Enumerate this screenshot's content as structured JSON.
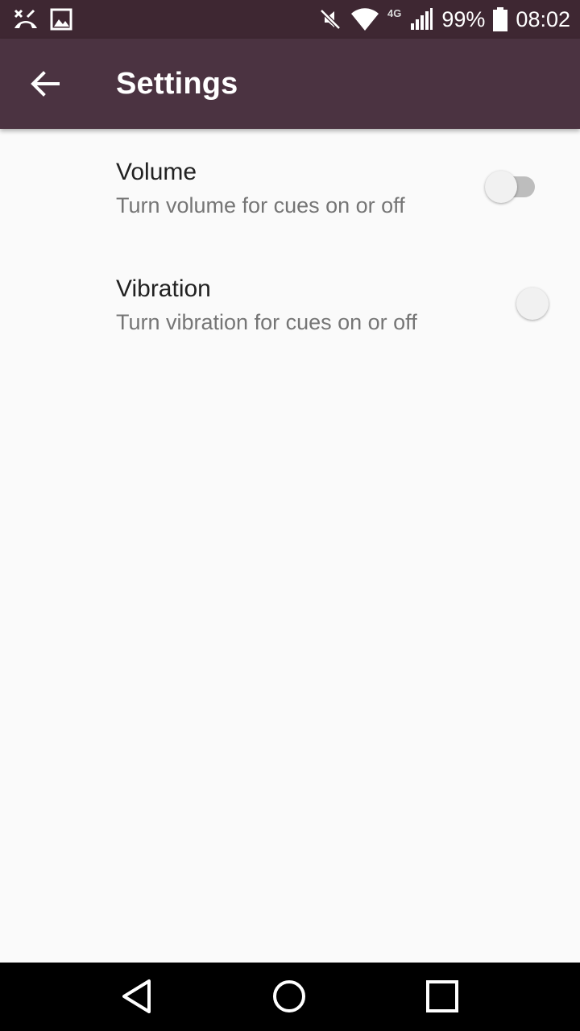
{
  "status_bar": {
    "left_icons": [
      "missed-call-icon",
      "image-icon"
    ],
    "right_icons": [
      "mute-icon",
      "wifi-icon",
      "lte-4g-icon",
      "signal-icon",
      "battery-icon"
    ],
    "network_label": "4G",
    "battery_percent": "99%",
    "time": "08:02"
  },
  "toolbar": {
    "back_icon": "arrow-back-icon",
    "title": "Settings",
    "background": "#4b3341"
  },
  "preferences": [
    {
      "title": "Volume",
      "summary": "Turn volume for cues on or off",
      "enabled": false
    },
    {
      "title": "Vibration",
      "summary": "Turn vibration for cues on or off",
      "enabled": false
    }
  ],
  "nav_bar": {
    "buttons": [
      "back-triangle-icon",
      "home-circle-icon",
      "recents-square-icon"
    ]
  },
  "colors": {
    "status_bar": "#3e2732",
    "toolbar": "#4b3341",
    "background": "#fafafa",
    "title_text": "#212121",
    "summary_text": "#757575"
  }
}
